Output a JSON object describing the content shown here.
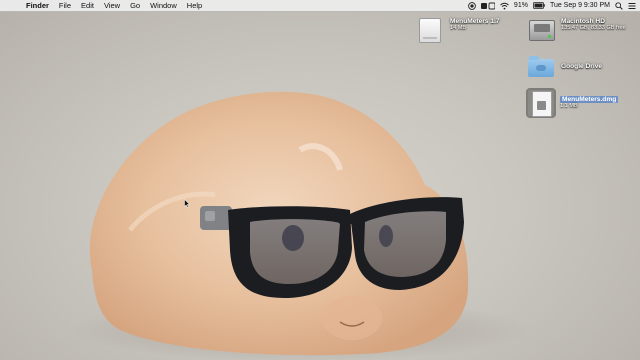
{
  "menubar": {
    "apple_glyph": "",
    "app_name": "Finder",
    "menus": [
      "File",
      "Edit",
      "View",
      "Go",
      "Window",
      "Help"
    ],
    "battery": "91%",
    "clock": "Tue Sep 9  9:30 PM"
  },
  "desktop_icons": {
    "menumeters_volume": {
      "name": "MenuMeters 1.7",
      "sub": "14 MB"
    },
    "macintosh_hd": {
      "name": "Macintosh HD",
      "sub": "135.47 GB, 83.33 GB free"
    },
    "google_drive": {
      "name": "Google Drive"
    },
    "menumeters_dmg": {
      "name": "MenuMeters.dmg",
      "sub": "1.1 MB",
      "selected": true
    }
  },
  "wallpaper": {
    "subject": "guinea pig wearing glasses"
  },
  "colors": {
    "selection": "#6d8fc4",
    "glasses": "#1b1d21",
    "fur": "#e8c2a0"
  },
  "icons": [
    "apple-icon",
    "record-icon",
    "menumeters-icon",
    "wifi-icon",
    "battery-icon",
    "search-icon",
    "notification-center-icon"
  ]
}
